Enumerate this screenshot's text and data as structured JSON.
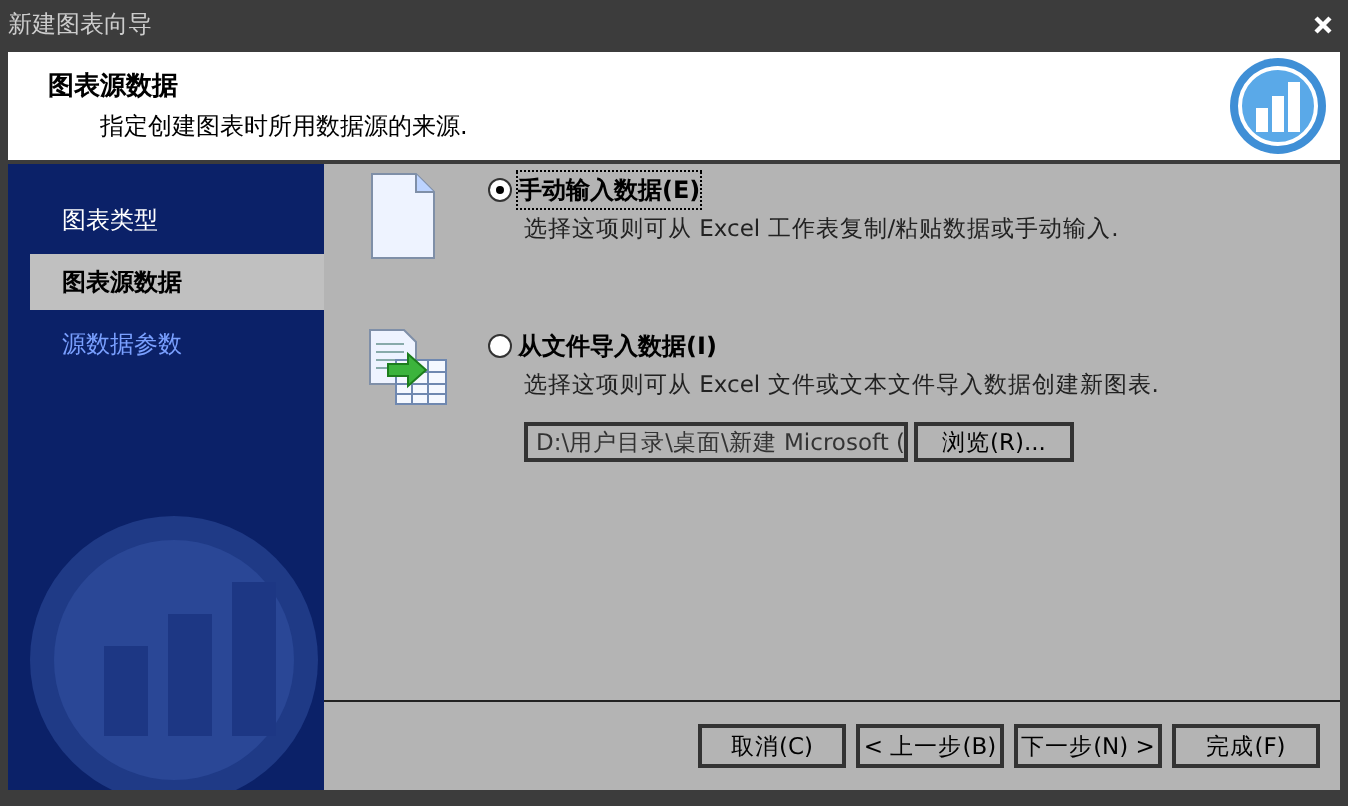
{
  "window": {
    "title": "新建图表向导"
  },
  "header": {
    "title": "图表源数据",
    "subtitle": "指定创建图表时所用数据源的来源."
  },
  "steps": [
    {
      "label": "图表类型",
      "selected": false,
      "enabled": true
    },
    {
      "label": "图表源数据",
      "selected": true,
      "enabled": true
    },
    {
      "label": "源数据参数",
      "selected": false,
      "enabled": false
    }
  ],
  "options": [
    {
      "kind": "manual",
      "label": "手动输入数据(E)",
      "description": "选择这项则可从 Excel 工作表复制/粘贴数据或手动输入.",
      "selected": true
    },
    {
      "kind": "file",
      "label": "从文件导入数据(I)",
      "description": "选择这项则可从 Excel 文件或文本文件导入数据创建新图表.",
      "selected": false,
      "path": "D:\\用户目录\\桌面\\新建 Microsoft (",
      "browse": "浏览(R)..."
    }
  ],
  "buttons": [
    "取消(C)",
    "< 上一步(B)",
    "下一步(N) >",
    "完成(F)"
  ]
}
